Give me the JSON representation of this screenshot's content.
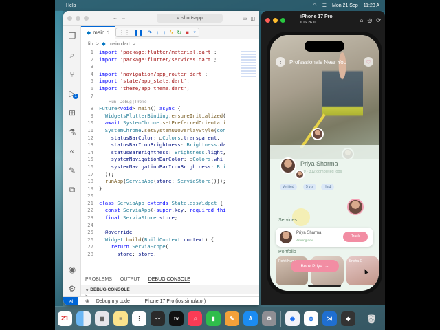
{
  "menubar": {
    "help": "Help",
    "date": "Mon 21 Sep",
    "time": "11:23 A"
  },
  "vscode": {
    "search": "shortsapp",
    "tab": "main.d",
    "breadcrumb": [
      "lib",
      ">",
      "main.dart",
      ">",
      "..."
    ],
    "code_lines": [
      {
        "n": "1",
        "html": "<span class='kw'>import</span> <span class='str'>'package:flutter/material.dart'</span>;"
      },
      {
        "n": "2",
        "html": "<span class='kw'>import</span> <span class='str'>'package:flutter/services.dart'</span>;"
      },
      {
        "n": "3",
        "html": ""
      },
      {
        "n": "4",
        "html": "<span class='kw'>import</span> <span class='str'>'navigation/app_router.dart'</span>;"
      },
      {
        "n": "5",
        "html": "<span class='kw'>import</span> <span class='str'>'state/app_state.dart'</span>;"
      },
      {
        "n": "6",
        "html": "<span class='kw'>import</span> <span class='str'>'theme/app_theme.dart'</span>;"
      },
      {
        "n": "7",
        "html": ""
      },
      {
        "lens": "Run | Debug | Profile"
      },
      {
        "n": "8",
        "html": "<span class='ty'>Future</span>&lt;<span class='kw'>void</span>&gt; <span class='fn'>main</span>() <span class='kw'>async</span> {"
      },
      {
        "n": "9",
        "html": "  <span class='ty'>WidgetsFlutterBinding</span>.<span class='fn'>ensureInitialized</span>("
      },
      {
        "n": "10",
        "html": "  <span class='kw'>await</span> <span class='ty'>SystemChrome</span>.<span class='fn'>setPreferredOrientati</span>"
      },
      {
        "n": "11",
        "html": "  <span class='ty'>SystemChrome</span>.<span class='fn'>setSystemUIOverlayStyle</span>(<span class='ty'>con</span>"
      },
      {
        "n": "12",
        "html": "    <span class='var'>statusBarColor</span>: ◻<span class='ty'>Colors</span>.<span class='var'>transparent</span>,"
      },
      {
        "n": "13",
        "html": "    <span class='var'>statusBarIconBrightness</span>: <span class='ty'>Brightness</span>.<span class='var'>da</span>"
      },
      {
        "n": "14",
        "html": "    <span class='var'>statusBarBrightness</span>: <span class='ty'>Brightness</span>.<span class='var'>light</span>,"
      },
      {
        "n": "15",
        "html": "    <span class='var'>systemNavigationBarColor</span>: ◻<span class='ty'>Colors</span>.<span class='var'>whi</span>"
      },
      {
        "n": "16",
        "html": "    <span class='var'>systemNavigationBarIconBrightness</span>: <span class='ty'>Bri</span>"
      },
      {
        "n": "17",
        "html": "  ));"
      },
      {
        "n": "18",
        "html": "  <span class='fn'>runApp</span>(<span class='ty'>ServiaApp</span>(<span class='var'>store</span>: <span class='ty'>ServiaStore</span>()));"
      },
      {
        "n": "19",
        "html": "}"
      },
      {
        "n": "20",
        "html": ""
      },
      {
        "n": "21",
        "html": "<span class='kw'>class</span> <span class='ty'>ServiaApp</span> <span class='kw'>extends</span> <span class='ty'>StatelessWidget</span> {"
      },
      {
        "n": "22",
        "html": "  <span class='kw'>const</span> <span class='ty'>ServiaApp</span>({<span class='kw'>super</span>.<span class='var'>key</span>, <span class='kw'>required</span> <span class='kw'>thi</span>"
      },
      {
        "n": "23",
        "html": "  <span class='kw'>final</span> <span class='ty'>ServiaStore</span> <span class='var'>store</span>;"
      },
      {
        "n": "24",
        "html": ""
      },
      {
        "n": "25",
        "html": "  <span class='var'>@override</span>"
      },
      {
        "n": "26",
        "html": "  <span class='ty'>Widget</span> <span class='fn'>build</span>(<span class='ty'>BuildContext</span> <span class='var'>context</span>) {"
      },
      {
        "n": "27",
        "html": "    <span class='kw'>return</span> <span class='ty'>ServiaScope</span>("
      },
      {
        "n": "28",
        "html": "      <span class='var'>store</span>: <span class='var'>store</span>,"
      }
    ],
    "panel_tabs": [
      "PROBLEMS",
      "OUTPUT",
      "DEBUG CONSOLE"
    ],
    "panel_title": "DEBUG CONSOLE",
    "prompt": ">",
    "status": {
      "debug": "Debug my code",
      "device": "iPhone 17 Pro (ios simulator)"
    }
  },
  "simulator": {
    "device": "iPhone 17 Pro",
    "os": "iOS 26.0",
    "app": {
      "header": "Professionals Near You",
      "pro_name": "Priya Sharma",
      "pro_meta": "4.9 · 312 completed jobs",
      "chips": [
        "Verified",
        "5 yrs",
        "Hindi"
      ],
      "section_services": "Services",
      "service_name": "Priya Sharma",
      "service_status": "Arriving now",
      "service_pill": "Track",
      "section_portfolio": "Portfolio",
      "portfolio": [
        "Rohit Kumar",
        "",
        "Sneha G"
      ],
      "book_label": "Book Priya"
    }
  },
  "dock": {
    "calendar_day": "21",
    "items": [
      "finder",
      "launchpad",
      "notes",
      "reminders",
      "freeform",
      "appletv",
      "music",
      "numbers",
      "pages",
      "appstore",
      "settings",
      "proxyman",
      "chrome",
      "vscode",
      "simulator",
      "trash"
    ]
  }
}
